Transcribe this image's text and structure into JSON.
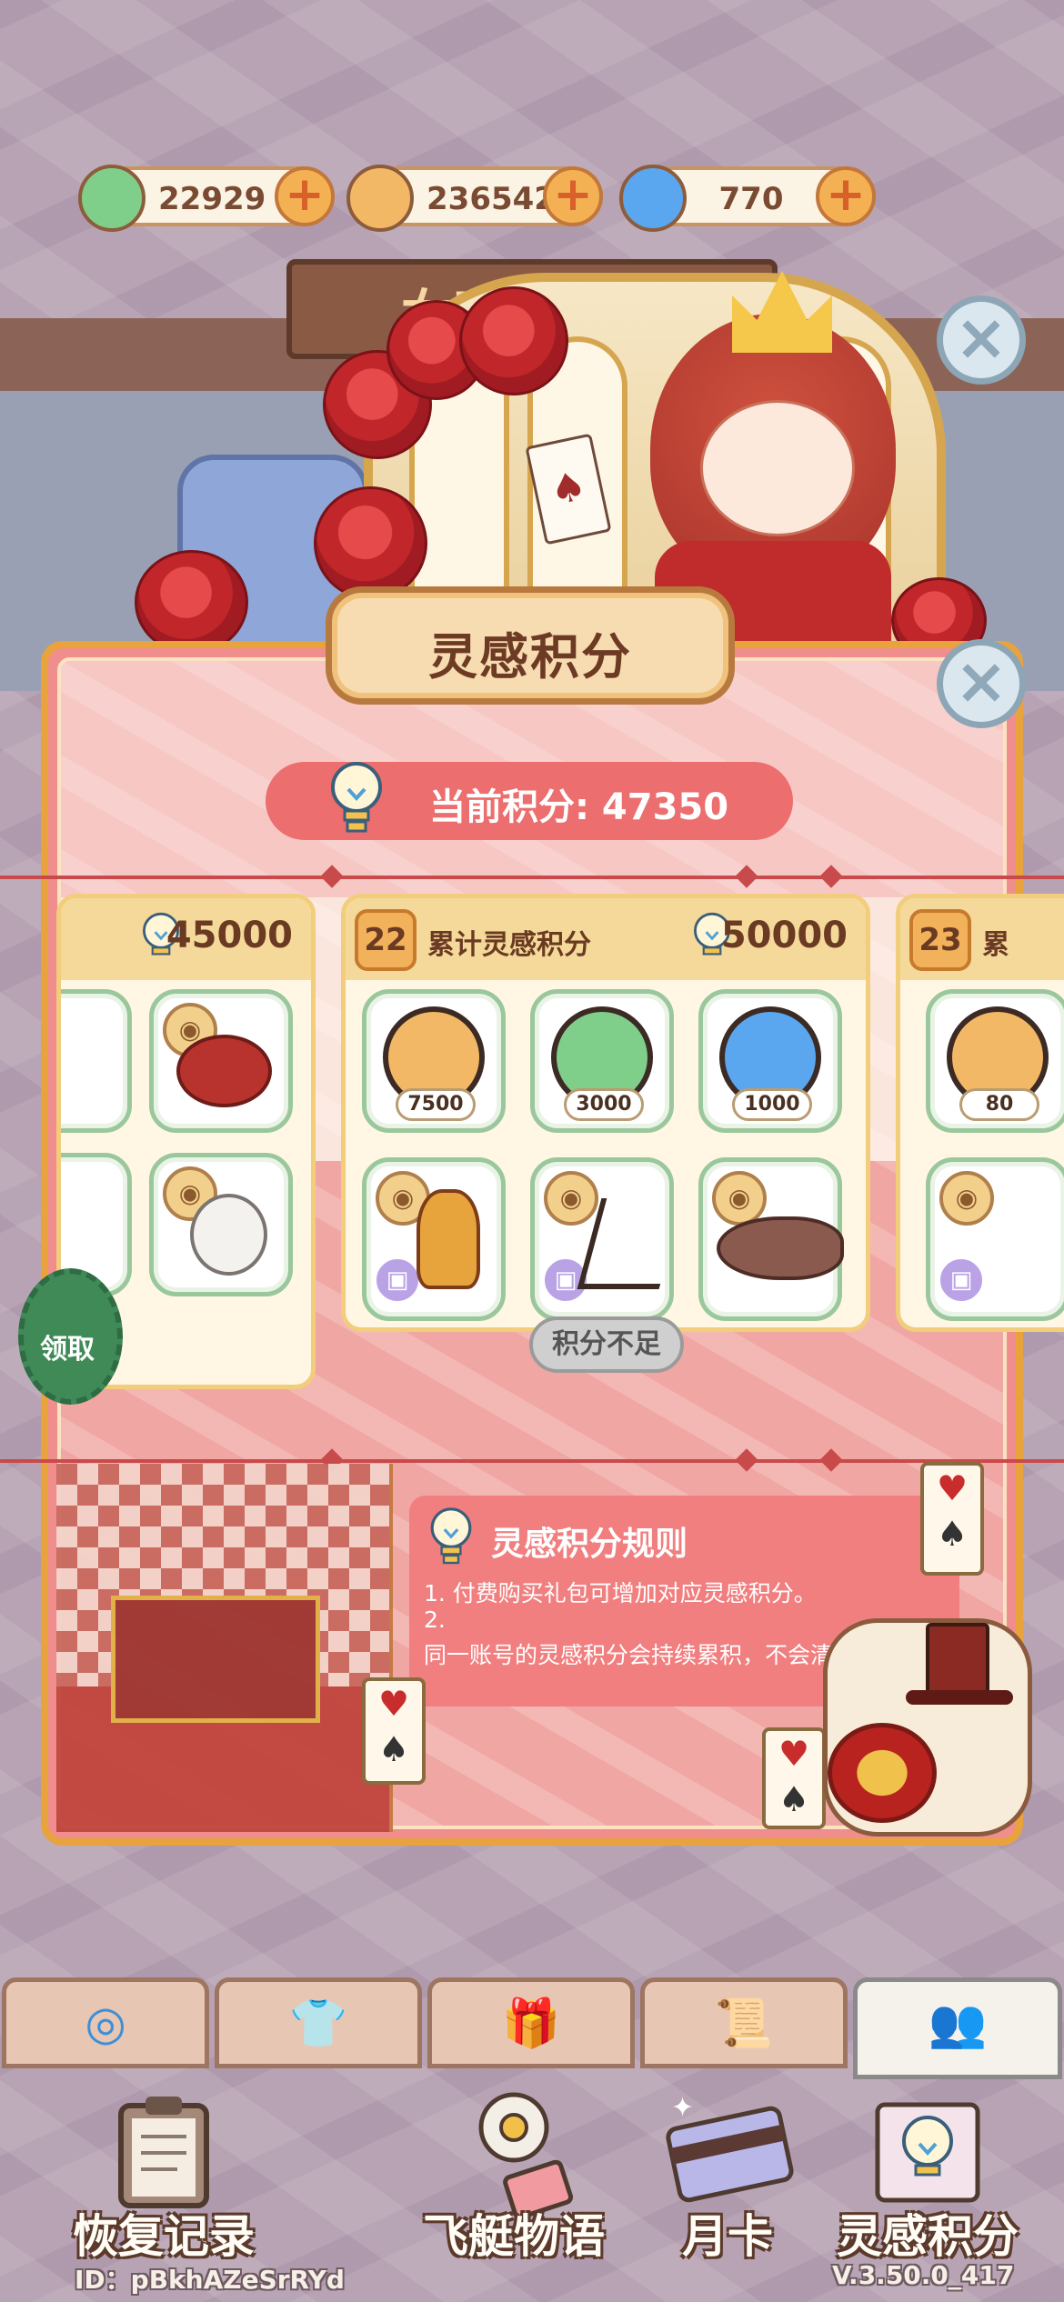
{
  "currencies": [
    {
      "name": "clover-currency",
      "value": "22929",
      "color": "#7fcf8b"
    },
    {
      "name": "sprout-currency",
      "value": "236542",
      "color": "#f2b866"
    },
    {
      "name": "swirl-currency",
      "value": "770",
      "color": "#5aa6ef"
    }
  ],
  "background_banner": "女王的",
  "panel": {
    "title": "灵感积分",
    "current_points_label": "当前积分: 47350"
  },
  "reward_left": {
    "target": "45000",
    "claim_label": "领取"
  },
  "reward_center": {
    "level": "22",
    "label": "累计灵感积分",
    "target": "50000",
    "items": [
      {
        "icon": "sprout-coin-icon",
        "qty": "7500",
        "color": "#f2b866"
      },
      {
        "icon": "clover-coin-icon",
        "qty": "3000",
        "color": "#7fcf8b"
      },
      {
        "icon": "swirl-coin-icon",
        "qty": "1000",
        "color": "#5aa6ef"
      }
    ],
    "status_button": "积分不足"
  },
  "reward_right": {
    "level": "23",
    "label_fragment": "累",
    "qty_fragment": "80"
  },
  "rules": {
    "title": "灵感积分规则",
    "lines": [
      "1. 付费购买礼包可增加对应灵感积分。",
      "2.",
      "同一账号的灵感积分会持续累积，不会清零。"
    ]
  },
  "tabs": [
    {
      "icon": "swirl-tab-icon",
      "glyph": "◎"
    },
    {
      "icon": "shirt-tab-icon",
      "glyph": "👕"
    },
    {
      "icon": "gift-tab-icon",
      "glyph": "🎁"
    },
    {
      "icon": "scroll-tab-icon",
      "glyph": "📜"
    },
    {
      "icon": "people-tab-icon",
      "glyph": "👥"
    }
  ],
  "bottom_nav": [
    {
      "label": "恢复记录",
      "icon": "clipboard-icon"
    },
    {
      "label": "飞艇物语",
      "icon": "airship-flower-icon"
    },
    {
      "label": "月卡",
      "icon": "card-icon"
    },
    {
      "label": "灵感积分",
      "icon": "bulb-frame-icon"
    }
  ],
  "meta": {
    "user_id": "ID：pBkhAZeSrRYd",
    "version": "V.3.50.0_417"
  }
}
